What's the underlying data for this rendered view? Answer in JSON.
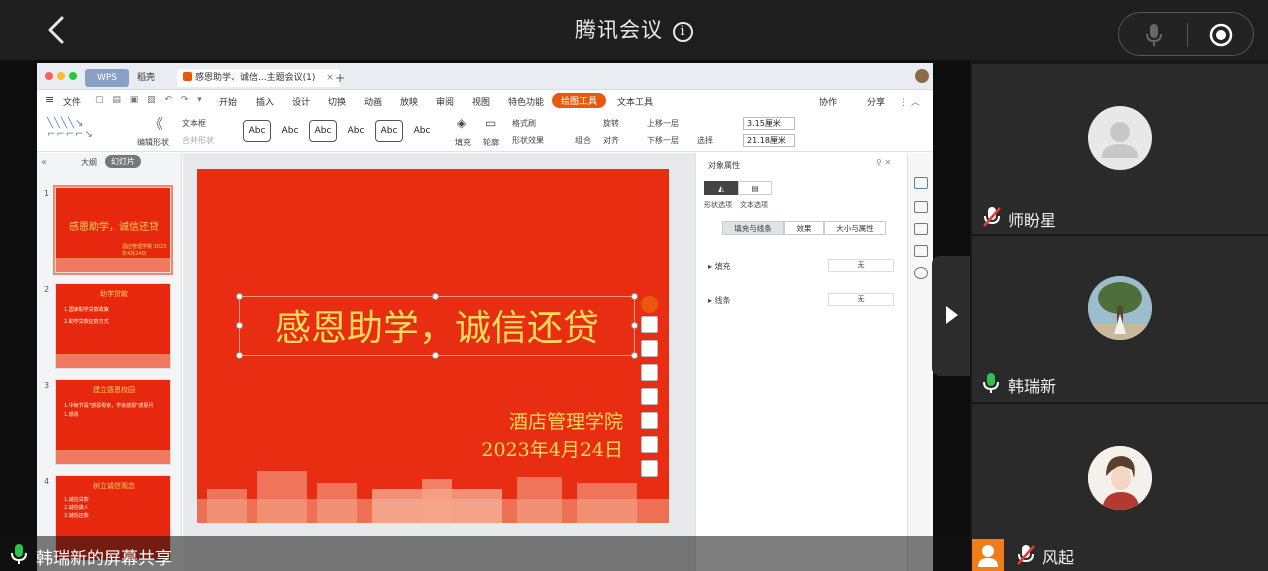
{
  "app": {
    "title": "腾讯会议",
    "info_symbol": "i"
  },
  "share": {
    "label": "韩瑞新的屏幕共享",
    "wps": {
      "tabs": {
        "wps": "WPS",
        "shell": "稻壳",
        "doc": "感恩助学、诚信...主题会议(1)"
      },
      "menu": [
        "文件",
        "开始",
        "插入",
        "设计",
        "切换",
        "动画",
        "放映",
        "审阅",
        "视图",
        "特色功能",
        "绘图工具",
        "文本工具"
      ],
      "menu_selected": "绘图工具",
      "menu_right": [
        "协作",
        "分享"
      ],
      "ribbon": {
        "edit_shape": "编辑形状",
        "textbox": "文本框",
        "merge_shape": "合并形状",
        "abc": [
          "Abc",
          "Abc",
          "Abc",
          "Abc",
          "Abc",
          "Abc"
        ],
        "fill": "填充",
        "outline": "轮廓",
        "format_brush": "格式刷",
        "shape_effect": "形状效果",
        "combine": "组合",
        "rotate": "旋转",
        "align": "对齐",
        "up_layer": "上移一层",
        "down_layer": "下移一层",
        "select": "选择",
        "height": "3.15厘米",
        "width": "21.18厘米"
      },
      "panel_tabs": {
        "outline": "大纲",
        "slides": "幻灯片"
      },
      "thumbnails": [
        {
          "num": "1",
          "title": "感恩助学，诚信还贷",
          "sub": "酒店管理学院 2023年4月24日"
        },
        {
          "num": "2",
          "title": "助学贷款",
          "lines": [
            "1.国家助学贷款政策",
            "2.助学贷款还款方式"
          ]
        },
        {
          "num": "3",
          "title": "建立感恩校园",
          "lines": [
            "1.中秋节是\"感恩母亲，学会感恩\"感恩月",
            "1.感恩"
          ]
        },
        {
          "num": "4",
          "title": "树立诚信观念",
          "lines": [
            "1.诚信贷款",
            "2.诚信做人",
            "3.诚信还款"
          ]
        }
      ],
      "slide": {
        "title": "感恩助学，诚信还贷",
        "subtitle1": "酒店管理学院",
        "subtitle2": "2023年4月24日"
      },
      "props": {
        "header": "对象属性",
        "tab_shape": "形状选项",
        "tab_text": "文本选项",
        "sub_tabs": [
          "填充与线条",
          "效果",
          "大小与属性"
        ],
        "fill_label": "填充",
        "fill_value": "无",
        "line_label": "线条",
        "line_value": "无"
      }
    }
  },
  "participants": [
    {
      "name": "师盼星",
      "mic": "muted"
    },
    {
      "name": "韩瑞新",
      "mic": "active"
    },
    {
      "name": "风起",
      "mic": "muted"
    }
  ],
  "colors": {
    "accent": "#e8590c",
    "slide_red": "#e92d12",
    "slide_gold": "#f3dc5c",
    "mic_green": "#2fc24a"
  }
}
